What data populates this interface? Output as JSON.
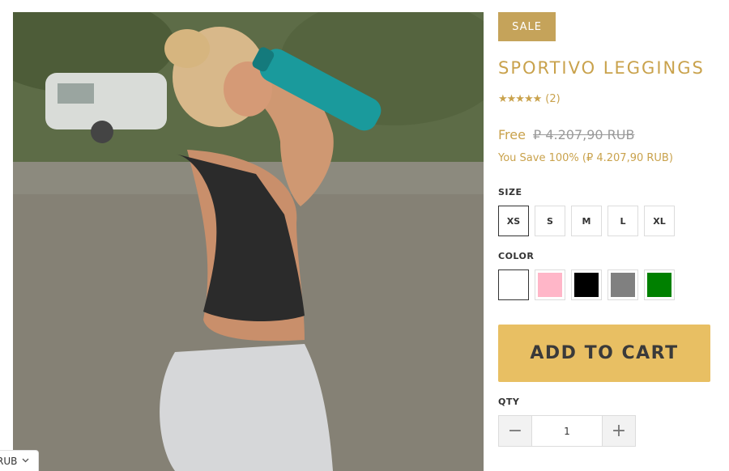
{
  "product": {
    "badge": "SALE",
    "title": "SPORTIVO LEGGINGS",
    "rating_stars": "★★★★★",
    "rating_count": "(2)",
    "price_current": "Free",
    "price_original": "₽ 4.207,90 RUB",
    "you_save": "You Save 100% (₽ 4.207,90 RUB)"
  },
  "options": {
    "size_label": "SIZE",
    "sizes": [
      "XS",
      "S",
      "M",
      "L",
      "XL"
    ],
    "selected_size": "XS",
    "color_label": "COLOR",
    "colors": [
      "#ffffff",
      "#ffb6c8",
      "#000000",
      "#808080",
      "#008000"
    ],
    "selected_color": "#ffffff"
  },
  "cart": {
    "add_to_cart_label": "ADD TO CART",
    "qty_label": "QTY",
    "qty_value": "1",
    "minus_label": "−",
    "plus_label": "+"
  },
  "currency_selector": {
    "value": "RUB",
    "icon": "chevron-down-icon"
  }
}
